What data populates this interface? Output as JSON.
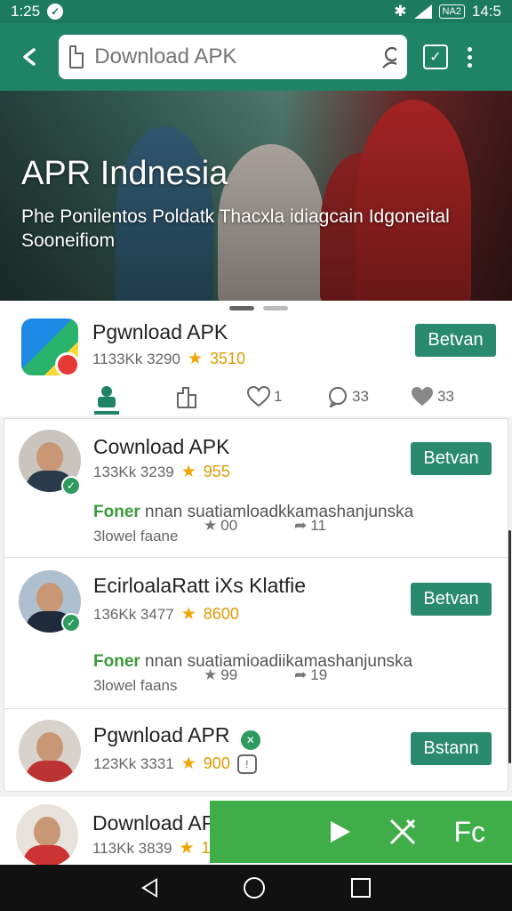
{
  "status_bar": {
    "time": "1:25",
    "battery": "NA2",
    "clock_right": "14:5"
  },
  "search": {
    "placeholder": "Download APK"
  },
  "hero": {
    "title": "APR Indnesia",
    "subtitle": "Phe Ponilentos Poldatk Thacxla idiagcain Idgoneital Sooneifiom"
  },
  "top_app": {
    "name": "Pgwnload APK",
    "downloads": "1133Kk 3290",
    "rating": "3510",
    "button_label": "Betvan"
  },
  "tabs": [
    {
      "icon": "home-icon",
      "count": ""
    },
    {
      "icon": "share-icon",
      "count": ""
    },
    {
      "icon": "heart-icon",
      "count": "1"
    },
    {
      "icon": "comment-icon",
      "count": "33"
    },
    {
      "icon": "heart-filled-icon",
      "count": "33"
    }
  ],
  "feed": [
    {
      "name": "Cownload APK",
      "downloads": "133Kk 3239",
      "rating": "955",
      "button_label": "Betvan",
      "desc_bold": "Foner",
      "desc_rest": " nnan suatiamloadkkamashanjunska",
      "stat_label": "3lowel faane",
      "stat_stars": "00",
      "stat_shares": "11"
    },
    {
      "name": "EcirloalaRatt iXs Klatfie",
      "downloads": "136Kk 3477",
      "rating": "8600",
      "button_label": "Betvan",
      "desc_bold": "Foner",
      "desc_rest": " nnan suatiamioadiikamashanjunska",
      "stat_label": "3lowel faans",
      "stat_stars": "99",
      "stat_shares": "19"
    },
    {
      "name": "Pgwnload APR",
      "downloads": "123Kk 3331",
      "rating": "900",
      "button_label": "Bstann"
    }
  ],
  "bottom_app": {
    "name": "Download AP",
    "downloads": "113Kk 3839",
    "rating": "1"
  },
  "overlay": {
    "label": "Fc"
  },
  "colors": {
    "primary": "#1f8466",
    "button": "#2a8a6d",
    "overlay": "#3fae49",
    "star": "#f2a400"
  }
}
